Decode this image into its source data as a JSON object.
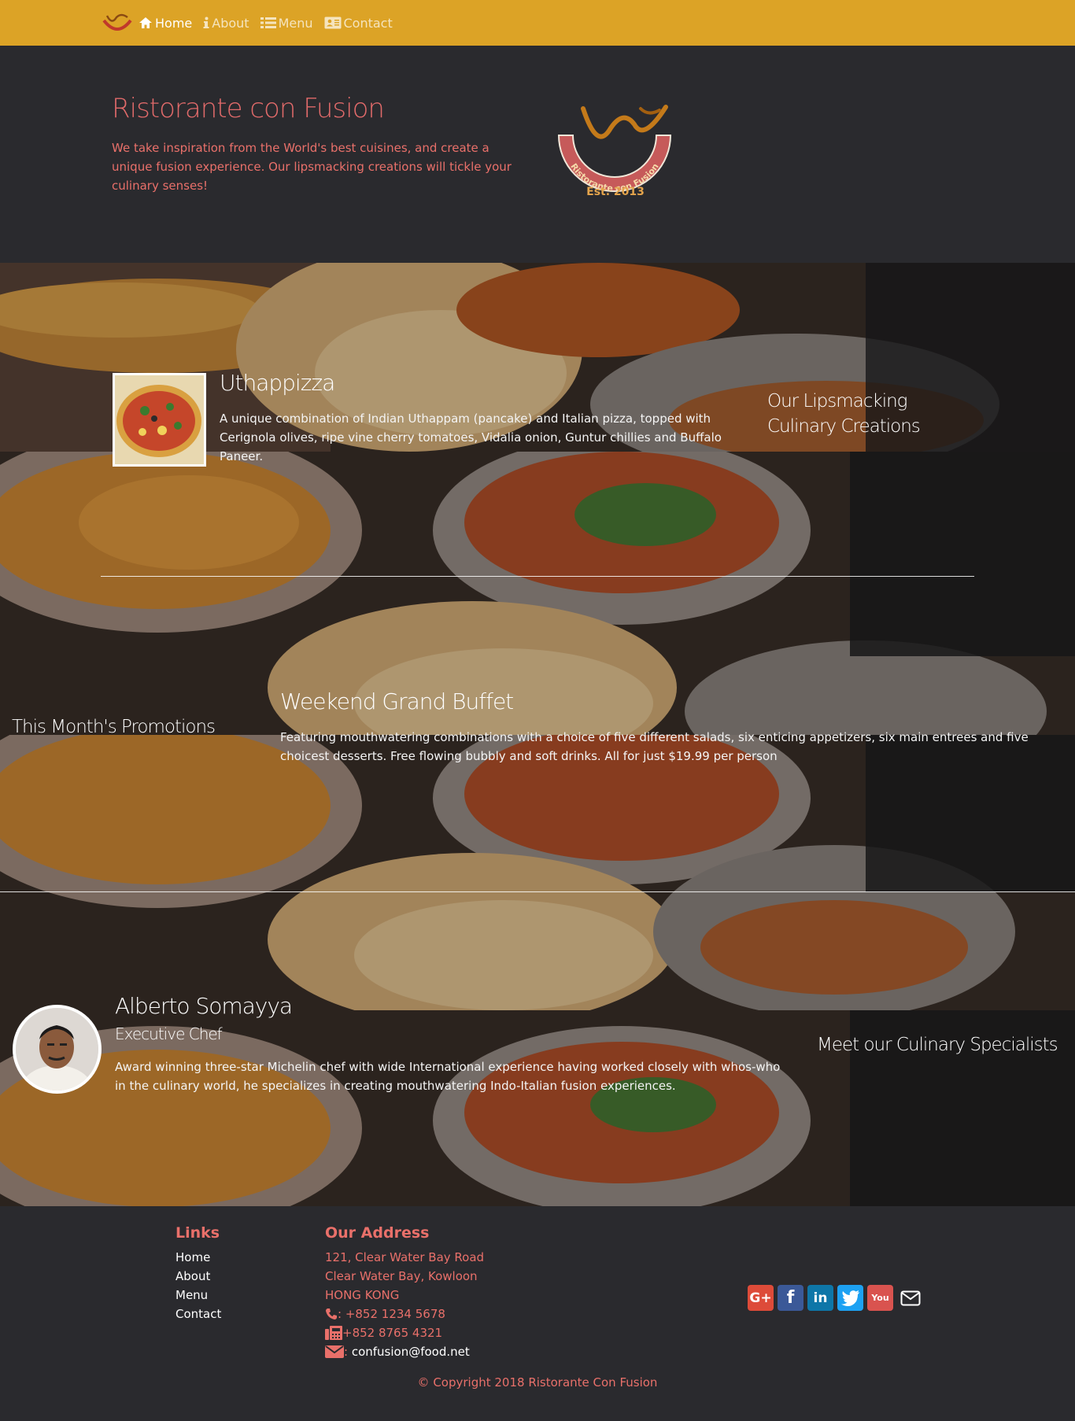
{
  "nav": {
    "items": [
      {
        "label": "Home",
        "icon": "home-icon",
        "active": true
      },
      {
        "label": "About",
        "icon": "info-icon",
        "active": false
      },
      {
        "label": "Menu",
        "icon": "list-icon",
        "active": false
      },
      {
        "label": "Contact",
        "icon": "address-card-icon",
        "active": false
      }
    ]
  },
  "jumbotron": {
    "title": "Ristorante con Fusion",
    "text": "We take inspiration from the World's best cuisines, and create a unique fusion experience. Our lipsmacking creations will tickle your culinary senses!",
    "logo_ring_text": "Ristorante con Fusion",
    "logo_est": "Est. 2013"
  },
  "dish": {
    "name": "Uthappizza",
    "description": "A unique combination of Indian Uthappam (pancake) and Italian pizza, topped with Cerignola olives, ripe vine cherry tomatoes, Vidalia onion, Guntur chillies and Buffalo Paneer.",
    "side_heading": "Our Lipsmacking Culinary Creations"
  },
  "promotion": {
    "side_heading": "This Month's Promotions",
    "name": "Weekend Grand Buffet",
    "description": "Featuring mouthwatering combinations with a choice of five different salads, six enticing appetizers, six main entrees and five choicest desserts. Free flowing bubbly and soft drinks. All for just $19.99 per person"
  },
  "leader": {
    "name": "Alberto Somayya",
    "designation": "Executive Chef",
    "description": "Award winning three-star Michelin chef with wide International experience having worked closely with whos-who in the culinary world, he specializes in creating mouthwatering Indo-Italian fusion experiences.",
    "side_heading": "Meet our Culinary Specialists"
  },
  "footer": {
    "links_heading": "Links",
    "links": [
      "Home",
      "About",
      "Menu",
      "Contact"
    ],
    "address_heading": "Our Address",
    "address_lines": [
      "121, Clear Water Bay Road",
      "Clear Water Bay, Kowloon",
      "HONG KONG"
    ],
    "phone": ": +852 1234 5678",
    "fax": " +852 8765 4321",
    "email": "confusion@food.net",
    "social": [
      {
        "name": "google-plus-icon",
        "glyph": "G+",
        "color": "#dd4b39"
      },
      {
        "name": "facebook-icon",
        "glyph": "f",
        "color": "#3b5998"
      },
      {
        "name": "linkedin-icon",
        "glyph": "in",
        "color": "#0e76a8"
      },
      {
        "name": "twitter-icon",
        "glyph": "t",
        "color": "#1da1f2"
      },
      {
        "name": "youtube-icon",
        "glyph": "You",
        "color": "#d9534f"
      }
    ],
    "copyright": "© Copyright 2018 Ristorante Con Fusion"
  },
  "colors": {
    "navbar": "#dca326",
    "dark_bg": "#2a2a2e",
    "accent": "#e9706a"
  }
}
